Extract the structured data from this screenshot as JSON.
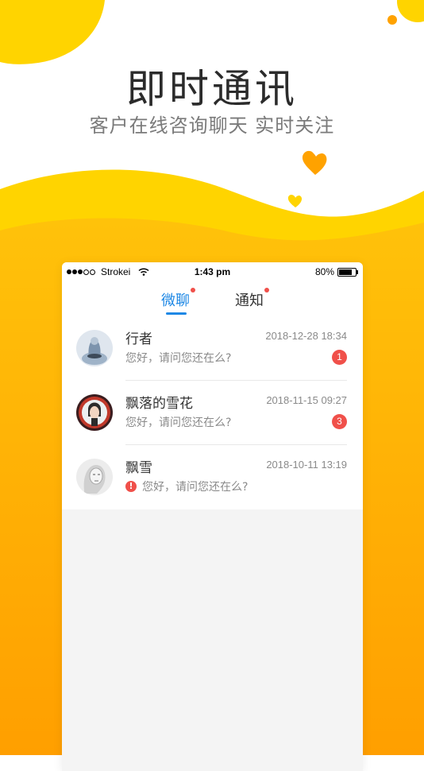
{
  "hero": {
    "title": "即时通讯",
    "subtitle": "客户在线咨询聊天 实时关注"
  },
  "colors": {
    "accent_yellow": "#ffd400",
    "accent_orange": "#ffa200",
    "tab_active": "#1e88e5",
    "badge_red": "#f0504a"
  },
  "status_bar": {
    "carrier": "Strokei",
    "time": "1:43 pm",
    "battery": "80%",
    "battery_level": 0.8
  },
  "tabs": [
    {
      "label": "微聊",
      "active": true,
      "has_dot": true
    },
    {
      "label": "通知",
      "active": false,
      "has_dot": true
    }
  ],
  "conversations": [
    {
      "name": "行者",
      "time": "2018-12-28 18:34",
      "message": "您好，请问您还在么?",
      "badge": "1",
      "avatar_icon": "sculpture-avatar-icon"
    },
    {
      "name": "飘落的雪花",
      "time": "2018-11-15 09:27",
      "message": "您好，请问您还在么?",
      "badge": "3",
      "avatar_icon": "portrait-avatar-icon"
    },
    {
      "name": "飘雪",
      "time": "2018-10-11 13:19",
      "message": "您好，请问您还在么?",
      "alert": "!",
      "avatar_icon": "sketch-avatar-icon"
    }
  ]
}
